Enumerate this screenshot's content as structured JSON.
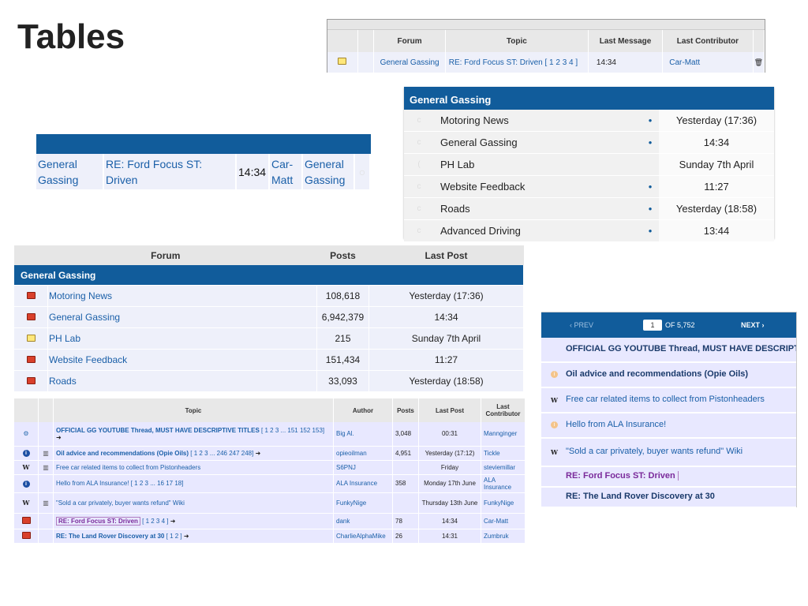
{
  "slide": {
    "title": "Tables"
  },
  "panel1": {
    "headers": [
      "Forum",
      "Topic",
      "Last Message",
      "Last Contributor"
    ],
    "row": {
      "forum": "General Gassing",
      "topic": "RE: Ford Focus ST: Driven",
      "pages": "[ 1 2 3 4 ]",
      "last_message": "14:34",
      "contributor": "Car-Matt"
    }
  },
  "panel2": {
    "row": {
      "forum_line1": "General",
      "forum_line2": "Gassing",
      "topic": "RE: Ford Focus ST: Driven",
      "time": "14:34",
      "contrib_line1": "Car-",
      "contrib_line2": "Matt",
      "forum2_line1": "General",
      "forum2_line2": "Gassing"
    }
  },
  "panel3": {
    "section": "General Gassing",
    "rows": [
      {
        "name": "Motoring News",
        "dot": "•",
        "time": "Yesterday (17:36)"
      },
      {
        "name": "General Gassing",
        "dot": "•",
        "time": "14:34"
      },
      {
        "name": "PH Lab",
        "dot": "",
        "time": "Sunday 7th April"
      },
      {
        "name": "Website Feedback",
        "dot": "•",
        "time": "11:27"
      },
      {
        "name": "Roads",
        "dot": "•",
        "time": "Yesterday (18:58)"
      },
      {
        "name": "Advanced Driving",
        "dot": "•",
        "time": "13:44"
      }
    ]
  },
  "panel4": {
    "headers": [
      "Forum",
      "Posts",
      "Last Post"
    ],
    "section": "General Gassing",
    "rows": [
      {
        "name": "Motoring News",
        "posts": "108,618",
        "last": "Yesterday (17:36)",
        "icon": "red"
      },
      {
        "name": "General Gassing",
        "posts": "6,942,379",
        "last": "14:34",
        "icon": "red"
      },
      {
        "name": "PH Lab",
        "posts": "215",
        "last": "Sunday 7th April",
        "icon": "yellow"
      },
      {
        "name": "Website Feedback",
        "posts": "151,434",
        "last": "11:27",
        "icon": "red"
      },
      {
        "name": "Roads",
        "posts": "33,093",
        "last": "Yesterday (18:58)",
        "icon": "red"
      }
    ]
  },
  "panel5": {
    "headers": [
      "Topic",
      "Author",
      "Posts",
      "Last Post",
      "Last Contributor"
    ],
    "rows": [
      {
        "topic": "OFFICIAL GG YOUTUBE Thread, MUST HAVE DESCRIPTIVE TITLES",
        "pages": "[ 1 2 3 ... 151 152 153]",
        "author": "Big Al.",
        "posts": "3,048",
        "last": "00:31",
        "contrib": "Mannginger",
        "bold": true
      },
      {
        "topic": "Oil advice and recommendations (Opie Oils)",
        "pages": "[ 1 2 3 ... 246 247 248]",
        "author": "opieoilman",
        "posts": "4,951",
        "last": "Yesterday (17:12)",
        "contrib": "Tickle",
        "bold": true
      },
      {
        "topic": "Free car related items to collect from Pistonheaders",
        "pages": "",
        "author": "S6PNJ",
        "posts": "",
        "last": "Friday",
        "contrib": "steviemillar",
        "bold": false
      },
      {
        "topic": "Hello from ALA Insurance!",
        "pages": "[ 1 2 3 ... 16 17 18]",
        "author": "ALA Insurance",
        "posts": "358",
        "last": "Monday 17th June",
        "contrib": "ALA Insurance",
        "bold": false
      },
      {
        "topic": "\"Sold a car privately, buyer wants refund\" Wiki",
        "pages": "",
        "author": "FunkyNige",
        "posts": "",
        "last": "Thursday 13th June",
        "contrib": "FunkyNige",
        "bold": false
      },
      {
        "topic": "RE: Ford Focus ST: Driven",
        "pages": "[ 1 2 3 4 ]",
        "author": "dank",
        "posts": "78",
        "last": "14:34",
        "contrib": "Car-Matt",
        "bold": true
      },
      {
        "topic": "RE: The Land Rover Discovery at 30",
        "pages": "[ 1 2 ]",
        "author": "CharlieAlphaMike",
        "posts": "26",
        "last": "14:31",
        "contrib": "Zumbruk",
        "bold": true
      }
    ]
  },
  "panel6": {
    "prev": "‹ PREV",
    "page": "1",
    "of": "OF 5,752",
    "next": "NEXT ›",
    "rows": [
      "OFFICIAL GG YOUTUBE Thread, MUST HAVE DESCRIPTIVI",
      "Oil advice and recommendations (Opie Oils)",
      "Free car related items to collect from Pistonheaders",
      "Hello from ALA Insurance!",
      "\"Sold a car privately, buyer wants refund\" Wiki",
      "RE: Ford Focus ST: Driven",
      "RE: The Land Rover Discovery at 30"
    ]
  }
}
